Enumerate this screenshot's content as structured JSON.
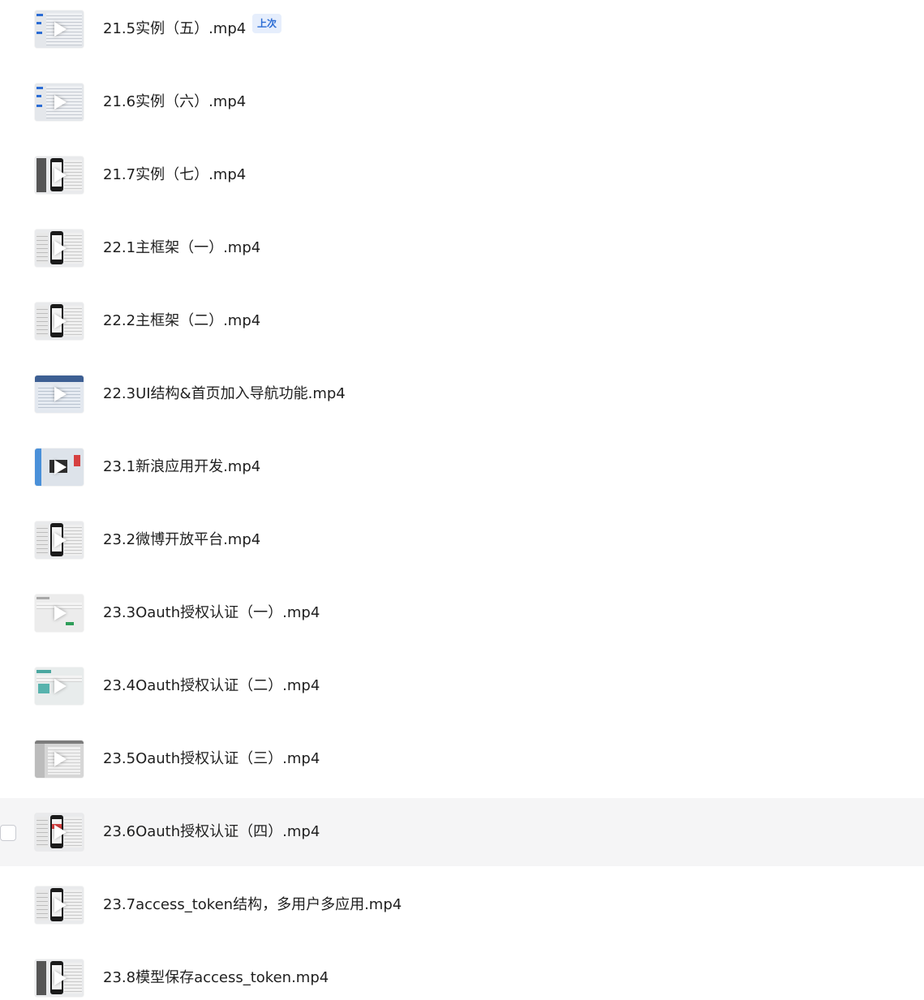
{
  "files": [
    {
      "name": "21.5实例（五）.mp4",
      "thumbnail": "ide",
      "badge": "上次"
    },
    {
      "name": "21.6实例（六）.mp4",
      "thumbnail": "ide"
    },
    {
      "name": "21.7实例（七）.mp4",
      "thumbnail": "phone-dark"
    },
    {
      "name": "22.1主框架（一）.mp4",
      "thumbnail": "phone"
    },
    {
      "name": "22.2主框架（二）.mp4",
      "thumbnail": "phone"
    },
    {
      "name": "22.3UI结构&首页加入导航功能.mp4",
      "thumbnail": "web"
    },
    {
      "name": "23.1新浪应用开发.mp4",
      "thumbnail": "sina"
    },
    {
      "name": "23.2微博开放平台.mp4",
      "thumbnail": "phone"
    },
    {
      "name": "23.3Oauth授权认证（一）.mp4",
      "thumbnail": "doc"
    },
    {
      "name": "23.4Oauth授权认证（二）.mp4",
      "thumbnail": "doc-green"
    },
    {
      "name": "23.5Oauth授权认证（三）.mp4",
      "thumbnail": "dialog"
    },
    {
      "name": "23.6Oauth授权认证（四）.mp4",
      "thumbnail": "phone-red",
      "hovered": true
    },
    {
      "name": "23.7access_token结构，多用户多应用.mp4",
      "thumbnail": "phone"
    },
    {
      "name": "23.8模型保存access_token.mp4",
      "thumbnail": "phone-dark"
    }
  ],
  "colors": {
    "hover_row": "#f5f5f6",
    "badge_text": "#2b6cd4",
    "badge_bg": "#e6eefc",
    "text": "#1f1f1f"
  }
}
